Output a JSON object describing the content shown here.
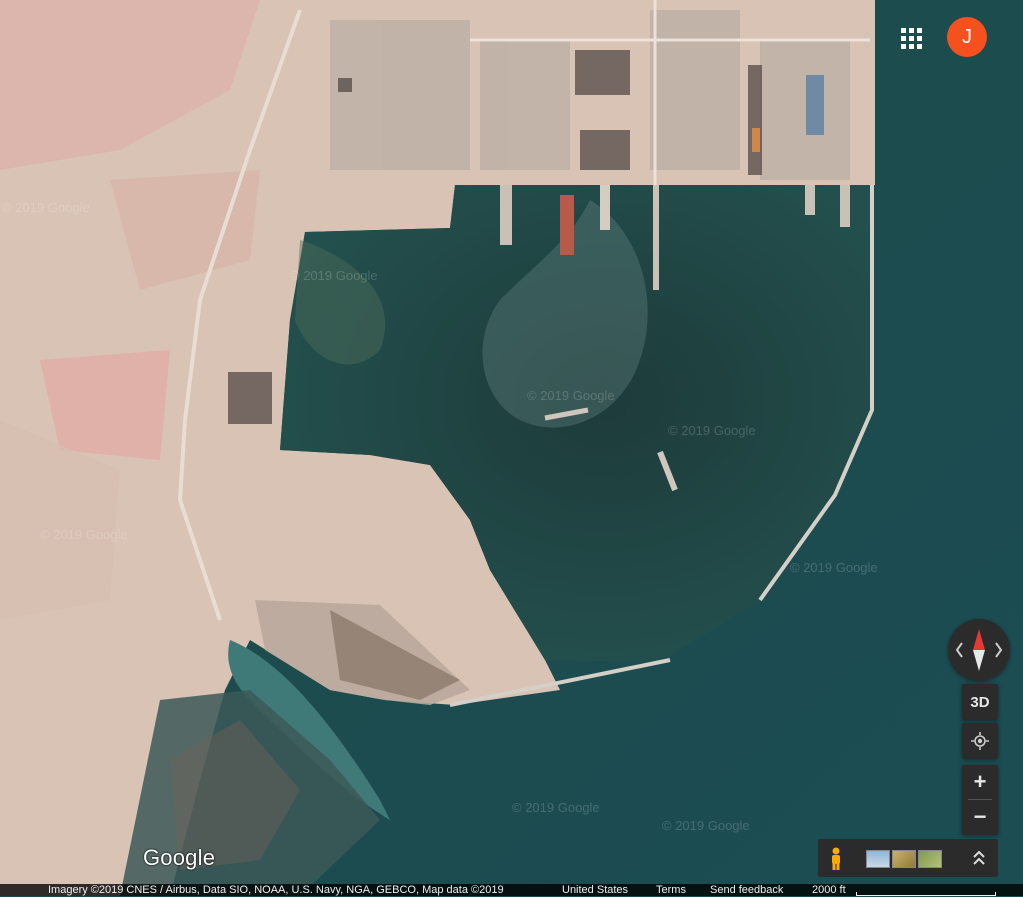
{
  "map": {
    "type": "satellite",
    "watermark": "© 2019 Google"
  },
  "header": {
    "apps_icon": "apps-grid-icon",
    "account_initial": "J",
    "account_color": "#f4511e"
  },
  "controls": {
    "compass_icon": "compass-icon",
    "tilt_label": "3D",
    "location_icon": "my-location-icon",
    "zoom_in_label": "+",
    "zoom_out_label": "−",
    "pegman_icon": "pegman-icon",
    "expand_icon": "chevron-up-icon"
  },
  "branding": {
    "logo_text": "Google"
  },
  "footer": {
    "attribution": "Imagery ©2019 CNES / Airbus, Data SIO, NOAA, U.S. Navy, NGA, GEBCO, Map data ©2019",
    "country": "United States",
    "terms": "Terms",
    "feedback": "Send feedback",
    "scale_label": "2000 ft"
  }
}
